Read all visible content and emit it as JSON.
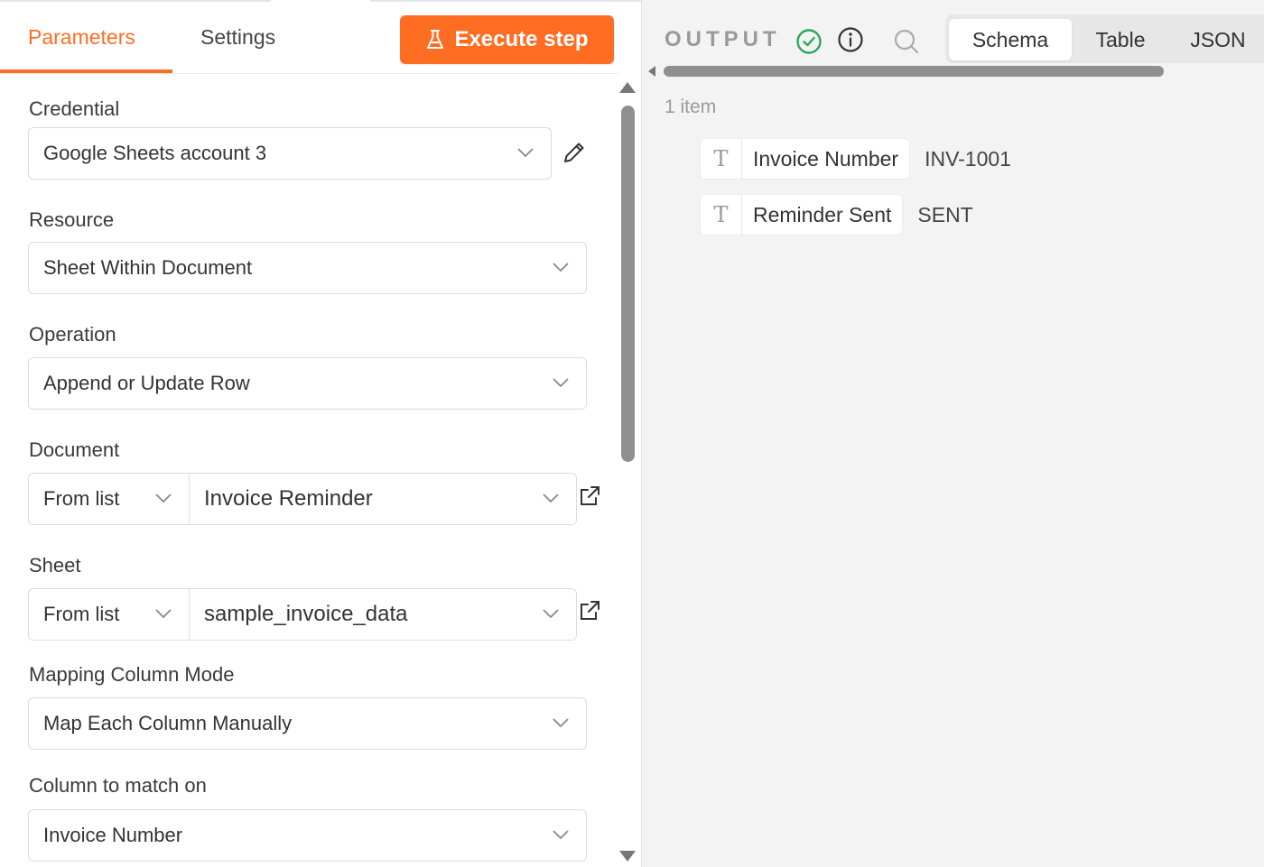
{
  "tabs": {
    "parameters": "Parameters",
    "settings": "Settings"
  },
  "execute_button": {
    "label": "Execute step",
    "icon": "flask-icon"
  },
  "form": {
    "credential": {
      "label": "Credential",
      "value": "Google Sheets account 3"
    },
    "resource": {
      "label": "Resource",
      "value": "Sheet Within Document"
    },
    "operation": {
      "label": "Operation",
      "value": "Append or Update Row"
    },
    "document": {
      "label": "Document",
      "mode": "From list",
      "value": "Invoice Reminder"
    },
    "sheet": {
      "label": "Sheet",
      "mode": "From list",
      "value": "sample_invoice_data"
    },
    "mapping_mode": {
      "label": "Mapping Column Mode",
      "value": "Map Each Column Manually"
    },
    "match_column": {
      "label": "Column to match on",
      "value": "Invoice Number"
    }
  },
  "output": {
    "title": "OUTPUT",
    "status_icon": "check-circle-icon",
    "view_tabs": [
      "Schema",
      "Table",
      "JSON"
    ],
    "active_view": "Schema",
    "items_count": "1 item",
    "fields": [
      {
        "type_icon": "T",
        "name": "Invoice Number",
        "value": "INV-1001"
      },
      {
        "type_icon": "T",
        "name": "Reminder Sent",
        "value": "SENT"
      }
    ]
  },
  "colors": {
    "accent": "#ff6d22",
    "success": "#29a85a"
  }
}
